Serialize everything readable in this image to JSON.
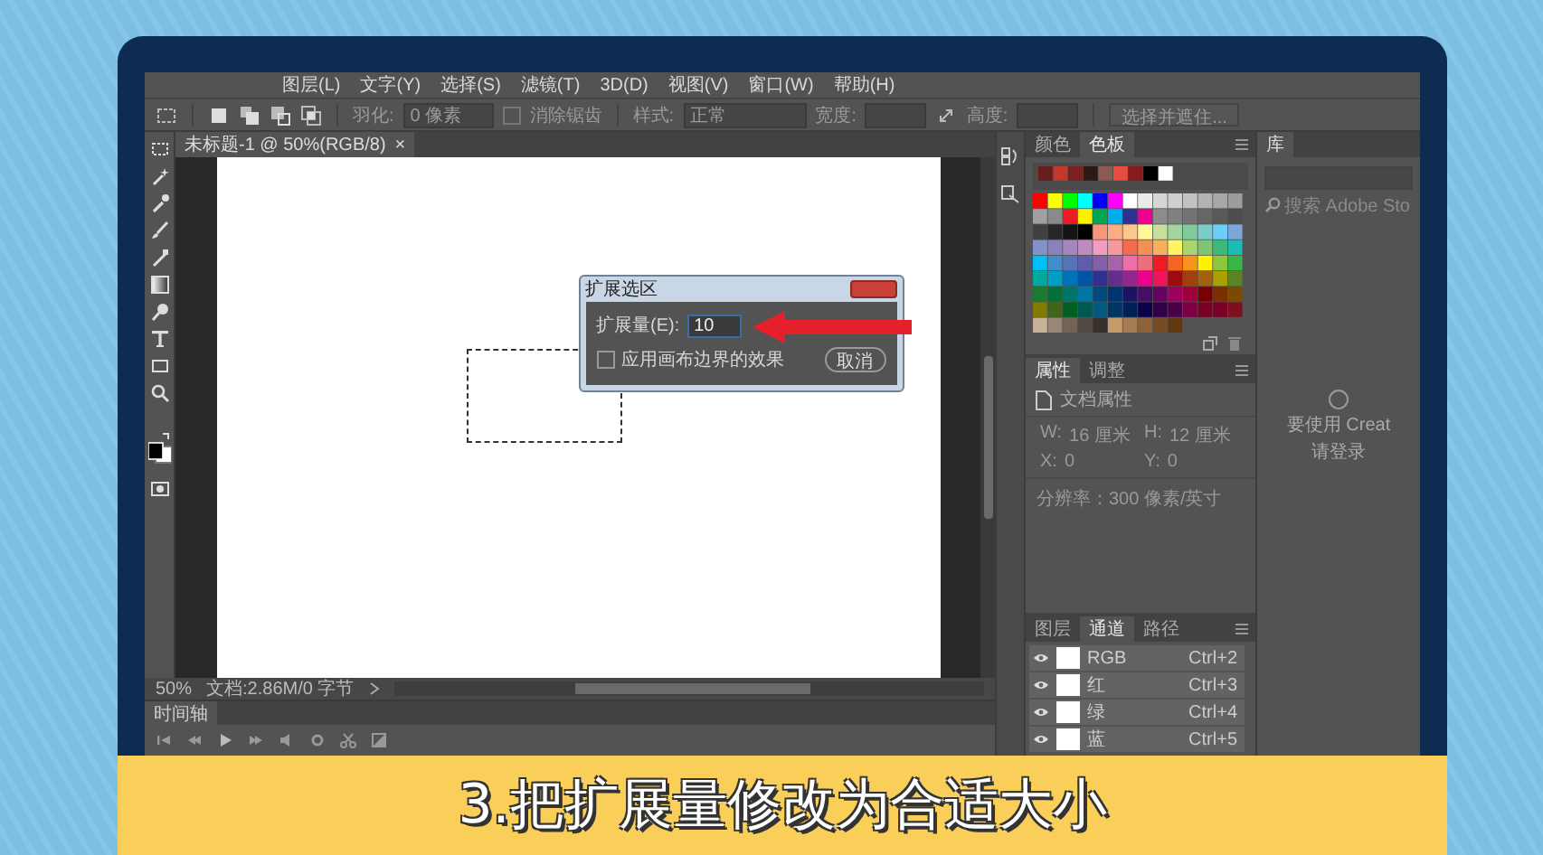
{
  "menu": [
    {
      "label": "图层(L)"
    },
    {
      "label": "文字(Y)"
    },
    {
      "label": "选择(S)"
    },
    {
      "label": "滤镜(T)"
    },
    {
      "label": "3D(D)"
    },
    {
      "label": "视图(V)"
    },
    {
      "label": "窗口(W)"
    },
    {
      "label": "帮助(H)"
    }
  ],
  "options_bar": {
    "feather_label": "羽化:",
    "feather_value": "0 像素",
    "antialias_label": "消除锯齿",
    "antialias_checked": false,
    "style_label": "样式:",
    "style_value": "正常",
    "width_label": "宽度:",
    "height_label": "高度:",
    "select_mask_button": "选择并遮住..."
  },
  "document_tab": {
    "title": "未标题-1 @ 50%(RGB/8)",
    "close": "×"
  },
  "dialog": {
    "title": "扩展选区",
    "expand_label": "扩展量(E):",
    "expand_value": "10",
    "apply_canvas_label": "应用画布边界的效果",
    "apply_canvas_checked": false,
    "cancel_button": "取消"
  },
  "status_bar": {
    "zoom": "50%",
    "doc_info": "文档:2.86M/0 字节"
  },
  "timeline": {
    "tab": "时间轴"
  },
  "swatches_panel": {
    "tabs": [
      {
        "label": "颜色",
        "selected": false
      },
      {
        "label": "色板",
        "selected": true
      }
    ]
  },
  "properties_panel": {
    "tabs": [
      {
        "label": "属性",
        "selected": true
      },
      {
        "label": "调整",
        "selected": false
      }
    ],
    "heading": "文档属性",
    "fields": [
      {
        "label": "W:",
        "value": "16 厘米"
      },
      {
        "label": "H:",
        "value": "12 厘米"
      },
      {
        "label": "X:",
        "value": "0"
      },
      {
        "label": "Y:",
        "value": "0"
      }
    ],
    "resolution": "分辨率：300 像素/英寸"
  },
  "channels_panel": {
    "tabs": [
      {
        "label": "图层",
        "selected": false
      },
      {
        "label": "通道",
        "selected": true
      },
      {
        "label": "路径",
        "selected": false
      }
    ],
    "channels": [
      {
        "name": "RGB",
        "shortcut": "Ctrl+2",
        "visible": true
      },
      {
        "name": "红",
        "shortcut": "Ctrl+3",
        "visible": true
      },
      {
        "name": "绿",
        "shortcut": "Ctrl+4",
        "visible": true
      },
      {
        "name": "蓝",
        "shortcut": "Ctrl+5",
        "visible": true
      }
    ]
  },
  "library_panel": {
    "tab": "库",
    "search_placeholder": "搜索 Adobe Sto",
    "message": [
      "要使用 Creat",
      "请登录"
    ]
  },
  "caption": "3.把扩展量修改为合适大小"
}
